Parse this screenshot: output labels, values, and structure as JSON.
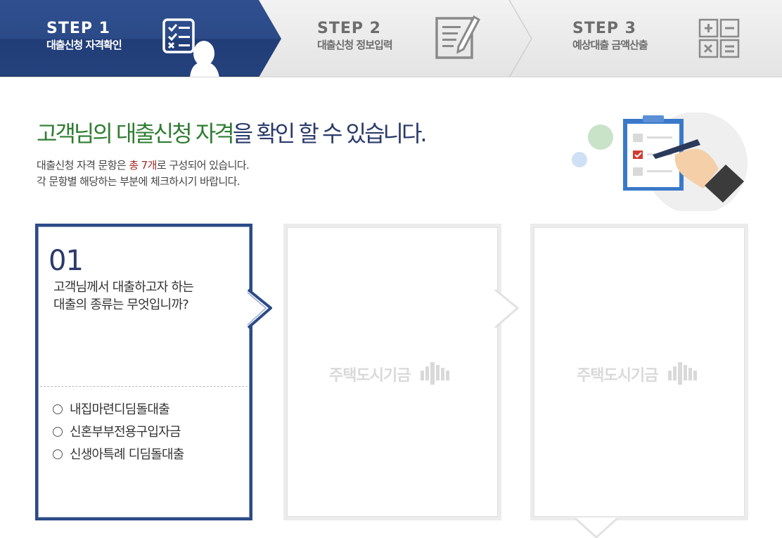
{
  "steps": [
    {
      "label": "STEP 1",
      "sub": "대출신청 자격확인",
      "active": true
    },
    {
      "label": "STEP 2",
      "sub": "대출신청 정보입력",
      "active": false
    },
    {
      "label": "STEP 3",
      "sub": "예상대출 금액산출",
      "active": false
    }
  ],
  "heading": {
    "green": "고객님의 대출신청 자격",
    "rest": "을 확인 할 수 있습니다."
  },
  "description": {
    "line1_pre": "대출신청 자격 문항은 ",
    "line1_highlight": "총 7개",
    "line1_post": "로 구성되어 있습니다.",
    "line2": "각 문항별 해당하는 부분에 체크하시기 바랍니다."
  },
  "question": {
    "number": "01",
    "line1": "고객님께서 대출하고자 하는",
    "line2": "대출의 종류는 무엇입니까?",
    "options": [
      "내집마련디딤돌대출",
      "신혼부부전용구입자금",
      "신생아특례 디딤돌대출"
    ]
  },
  "placeholder_cards": [
    {
      "watermark": "주택도시기금"
    },
    {
      "watermark": "주택도시기금"
    }
  ],
  "colors": {
    "brand_navy": "#2b4a87",
    "heading_green": "#2f7d32",
    "highlight_red": "#a02a2a"
  }
}
